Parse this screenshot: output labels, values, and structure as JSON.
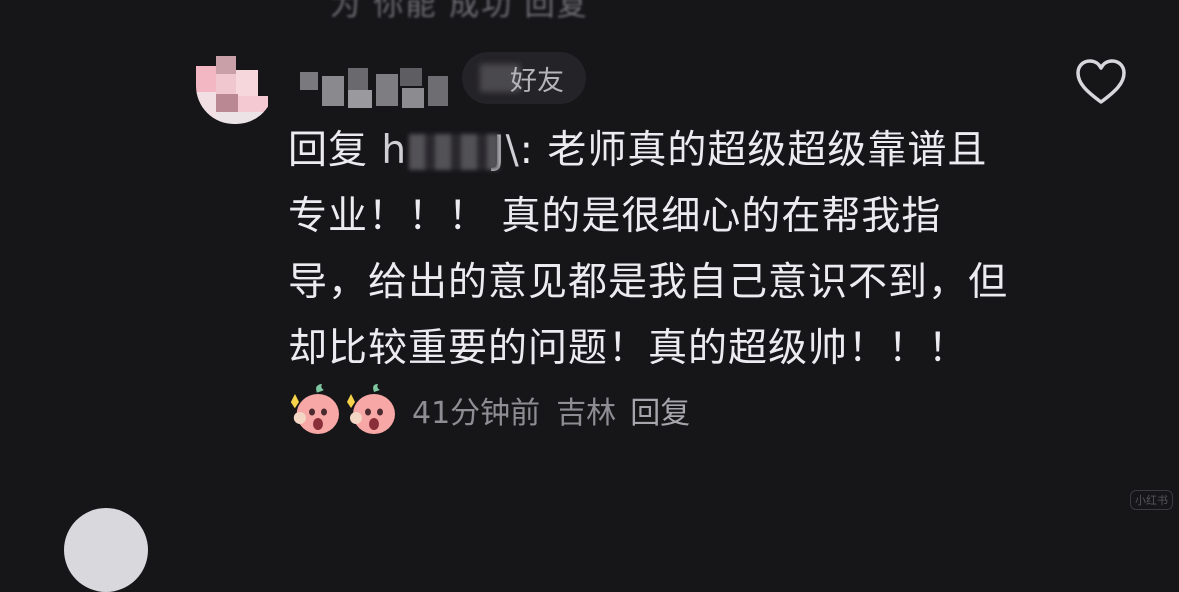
{
  "previous_comment_tail": "为 你能 成功 回复",
  "comment": {
    "author_badge": "好友",
    "reply_prefix": "回复",
    "reply_target": "h",
    "reply_target_tail": "J\\",
    "body": ": 老师真的超级超级靠谱且专业！！！ 真的是很细心的在帮我指导，给出的意见都是我自己意识不到，但却比较重要的问题！真的超级帅！！！",
    "time_ago": "41分钟前",
    "location": "吉林",
    "reply_label": "回复"
  },
  "icons": {
    "like": "heart-outline-icon",
    "emoji": "shocked-pink-blob-emoji"
  },
  "watermark": "小红书",
  "colors": {
    "background": "#161518",
    "text_primary": "#ecebef",
    "text_secondary": "#8e8d93",
    "badge_bg": "#242328",
    "emoji_pink": "#f7a7a5"
  }
}
